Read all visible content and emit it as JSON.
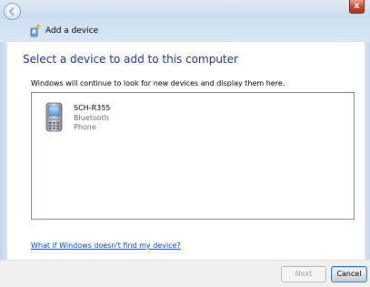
{
  "window": {
    "title": "Add a device",
    "close_label": "x"
  },
  "page": {
    "heading": "Select a device to add to this computer",
    "description": "Windows will continue to look for new devices and display them here."
  },
  "devices": [
    {
      "name": "SCH-R355",
      "connection": "Bluetooth",
      "category": "Phone",
      "icon": "mobile-phone-icon"
    }
  ],
  "help_link": "What if Windows doesn't find my device?",
  "buttons": {
    "next": "Next",
    "cancel": "Cancel"
  },
  "colors": {
    "heading": "#1e3287",
    "link": "#0645c4",
    "close_button": "#c7442a"
  }
}
